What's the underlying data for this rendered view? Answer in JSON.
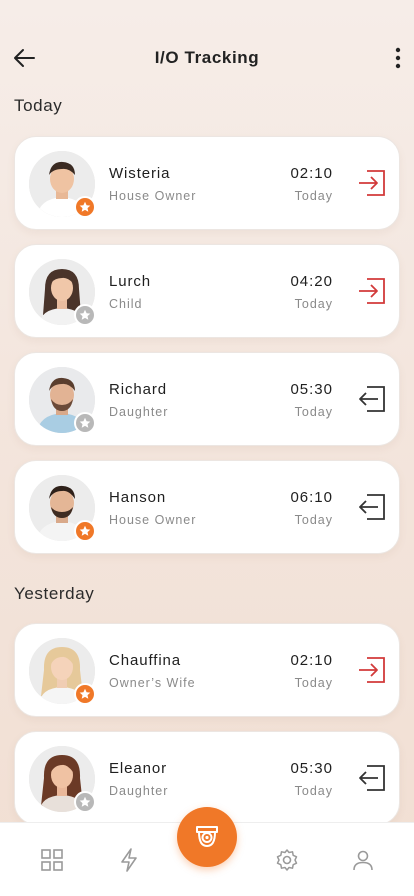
{
  "header": {
    "title": "I/O Tracking"
  },
  "sections": [
    {
      "title": "Today",
      "entries": [
        {
          "name": "Wisteria",
          "role": "House Owner",
          "time": "02:10",
          "day": "Today",
          "direction": "in",
          "badge": "gold",
          "icon": "enter-icon"
        },
        {
          "name": "Lurch",
          "role": "Child",
          "time": "04:20",
          "day": "Today",
          "direction": "in",
          "badge": "gray",
          "icon": "enter-icon"
        },
        {
          "name": "Richard",
          "role": "Daughter",
          "time": "05:30",
          "day": "Today",
          "direction": "out",
          "badge": "gray",
          "icon": "exit-icon"
        },
        {
          "name": "Hanson",
          "role": "House Owner",
          "time": "06:10",
          "day": "Today",
          "direction": "out",
          "badge": "gold",
          "icon": "exit-icon"
        }
      ]
    },
    {
      "title": "Yesterday",
      "entries": [
        {
          "name": "Chauffina",
          "role": "Owner’s Wife",
          "time": "02:10",
          "day": "Today",
          "direction": "in",
          "badge": "gold",
          "icon": "enter-icon"
        },
        {
          "name": "Eleanor",
          "role": "Daughter",
          "time": "05:30",
          "day": "Today",
          "direction": "out",
          "badge": "gray",
          "icon": "exit-icon"
        }
      ]
    }
  ],
  "nav": [
    {
      "icon": "grid-icon"
    },
    {
      "icon": "lightning-icon"
    },
    {
      "icon": "camera-icon",
      "active": true
    },
    {
      "icon": "gear-icon"
    },
    {
      "icon": "user-icon"
    }
  ],
  "colors": {
    "accent": "#f07828",
    "in": "#d23a3a",
    "out": "#333333",
    "badge_gray": "#b8b8b8"
  }
}
